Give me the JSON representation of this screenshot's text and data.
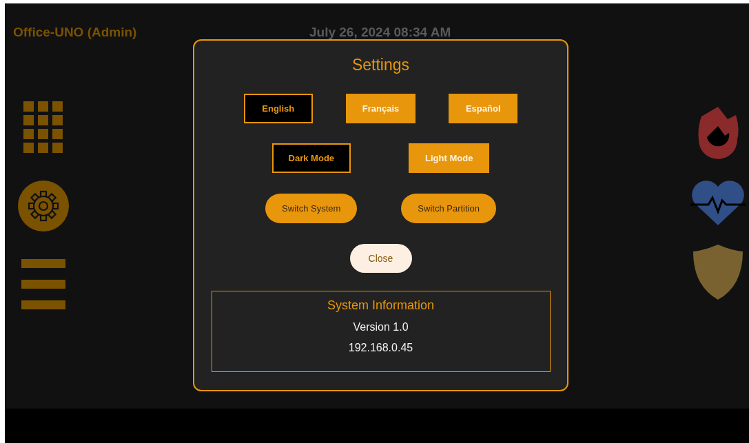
{
  "header": {
    "title": "Office-UNO (Admin)",
    "datetime": "July 26, 2024 08:34 AM"
  },
  "settings": {
    "title": "Settings",
    "languages": [
      {
        "label": "English",
        "selected": true
      },
      {
        "label": "Français",
        "selected": false
      },
      {
        "label": "Español",
        "selected": false
      }
    ],
    "modes": [
      {
        "label": "Dark Mode",
        "selected": true
      },
      {
        "label": "Light Mode",
        "selected": false
      }
    ],
    "actions": [
      "Switch System",
      "Switch Partition"
    ],
    "close": "Close",
    "system_info": {
      "title": "System Information",
      "lines": [
        "Version 1.0",
        "192.168.0.45"
      ]
    }
  }
}
